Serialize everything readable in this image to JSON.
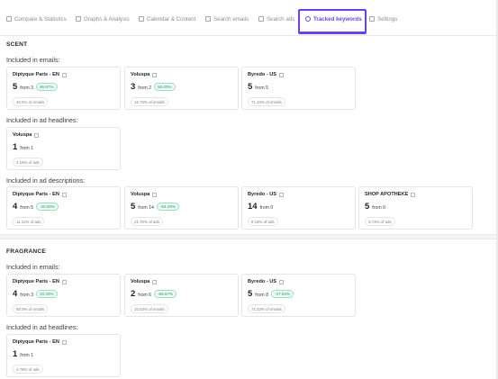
{
  "tabs": [
    {
      "label": "Compare & Statistics",
      "icon": "compare-icon"
    },
    {
      "label": "Graphs & Analysis",
      "icon": "chart-icon"
    },
    {
      "label": "Calendar & Content",
      "icon": "calendar-icon"
    },
    {
      "label": "Search emails",
      "icon": "mail-search-icon"
    },
    {
      "label": "Search ads",
      "icon": "ad-search-icon"
    },
    {
      "label": "Tracked keywords",
      "icon": "tag-icon",
      "active": true
    },
    {
      "label": "Settings",
      "icon": "gear-icon"
    }
  ],
  "colors": {
    "accent": "#6b46e8",
    "highlight": "#6d3df0",
    "positive": "#21a366"
  },
  "sections": [
    {
      "title": "SCENT",
      "groups": [
        {
          "label": "Included in emails:",
          "cards": [
            {
              "name": "Diptyque Paris - EN",
              "value": "5",
              "from": "from 3",
              "pct": "66.67%",
              "share": "40.5% of emails"
            },
            {
              "name": "Voluspa",
              "value": "3",
              "from": "from 2",
              "pct": "50.00%",
              "share": "16.76% of emails"
            },
            {
              "name": "Byredo - US",
              "value": "5",
              "from": "from 5",
              "pct": "",
              "share": "71.43% of emails"
            }
          ]
        },
        {
          "label": "Included in ad headlines:",
          "cards": [
            {
              "name": "Voluspa",
              "value": "1",
              "from": "from 1",
              "pct": "",
              "share": "4.15% of ads"
            }
          ]
        },
        {
          "label": "Included in ad descriptions:",
          "cards": [
            {
              "name": "Diptyque Paris - EN",
              "value": "4",
              "from": "from 5",
              "pct": "-20.00%",
              "share": "11.11% of ads"
            },
            {
              "name": "Voluspa",
              "value": "5",
              "from": "from 14",
              "pct": "-64.29%",
              "share": "21.70% of ads"
            },
            {
              "name": "Byredo - US",
              "value": "14",
              "from": "from 0",
              "pct": "",
              "share": "8.15% of ads"
            },
            {
              "name": "SHOP APOTHEKE",
              "value": "5",
              "from": "from 0",
              "pct": "",
              "share": "3.73% of ads"
            }
          ]
        }
      ]
    },
    {
      "title": "FRAGRANCE",
      "groups": [
        {
          "label": "Included in emails:",
          "cards": [
            {
              "name": "Diptyque Paris - EN",
              "value": "4",
              "from": "from 3",
              "pct": "33.33%",
              "share": "50.0% of emails"
            },
            {
              "name": "Voluspa",
              "value": "2",
              "from": "from 6",
              "pct": "-66.67%",
              "share": "10.53% of emails"
            },
            {
              "name": "Byredo - US",
              "value": "5",
              "from": "from 8",
              "pct": "-37.50%",
              "share": "71.43% of emails"
            }
          ]
        },
        {
          "label": "Included in ad headlines:",
          "cards": [
            {
              "name": "Diptyque Paris - EN",
              "value": "1",
              "from": "from 1",
              "pct": "",
              "share": "2.78% of ads"
            }
          ]
        }
      ]
    }
  ]
}
